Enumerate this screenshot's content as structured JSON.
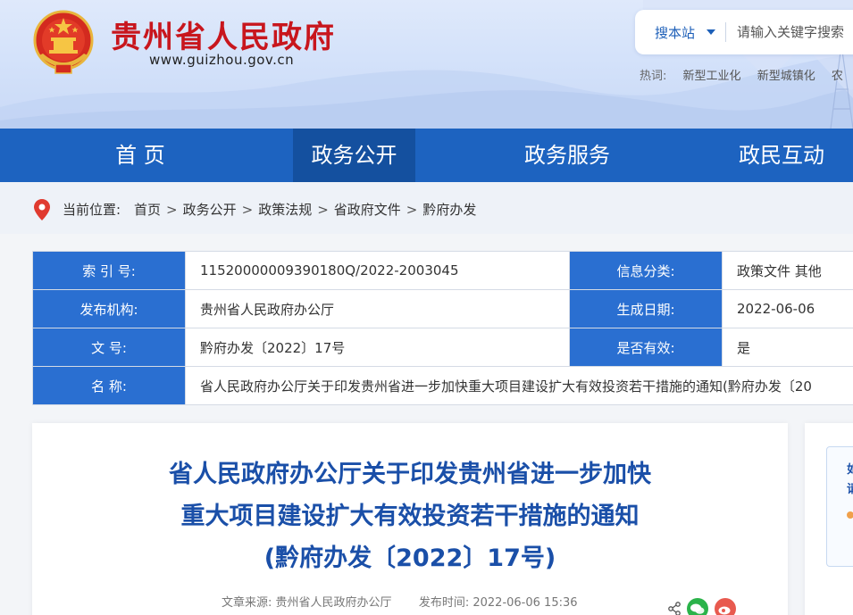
{
  "header": {
    "site_name": "贵州省人民政府",
    "site_url": "www.guizhou.gov.cn",
    "search": {
      "scope": "搜本站",
      "placeholder": "请输入关键字搜索"
    },
    "hotwords": {
      "label": "热词:",
      "items": [
        "新型工业化",
        "新型城镇化",
        "农"
      ]
    }
  },
  "nav": {
    "items": [
      "首 页",
      "政务公开",
      "政务服务",
      "政民互动"
    ],
    "active_index": 1
  },
  "breadcrumb": {
    "label": "当前位置:",
    "items": [
      "首页",
      "政务公开",
      "政策法规",
      "省政府文件",
      "黔府办发"
    ],
    "separator": ">"
  },
  "info": {
    "index_label": "索 引 号:",
    "index_value": "11520000009390180Q/2022-2003045",
    "category_label": "信息分类:",
    "category_value": "政策文件 其他",
    "publisher_label": "发布机构:",
    "publisher_value": "贵州省人民政府办公厅",
    "date_label": "生成日期:",
    "date_value": "2022-06-06",
    "doc_no_label": "文 号:",
    "doc_no_value": "黔府办发〔2022〕17号",
    "valid_label": "是否有效:",
    "valid_value": "是",
    "name_label": "名 称:",
    "name_value": "省人民政府办公厅关于印发贵州省进一步加快重大项目建设扩大有效投资若干措施的通知(黔府办发〔20"
  },
  "article": {
    "title_line1": "省人民政府办公厅关于印发贵州省进一步加快",
    "title_line2": "重大项目建设扩大有效投资若干措施的通知",
    "title_line3": "(黔府办发〔2022〕17号)",
    "source_label": "文章来源:",
    "source_value": "贵州省人民政府办公厅",
    "time_label": "发布时间:",
    "time_value": "2022-06-06 15:36"
  },
  "side": {
    "line1": "如",
    "line2": "请"
  },
  "colors": {
    "brand_red": "#c8161d",
    "nav_blue": "#1d63c0",
    "nav_active": "#14509f",
    "label_blue": "#2a6fd1",
    "title_blue": "#1a4fa8"
  }
}
